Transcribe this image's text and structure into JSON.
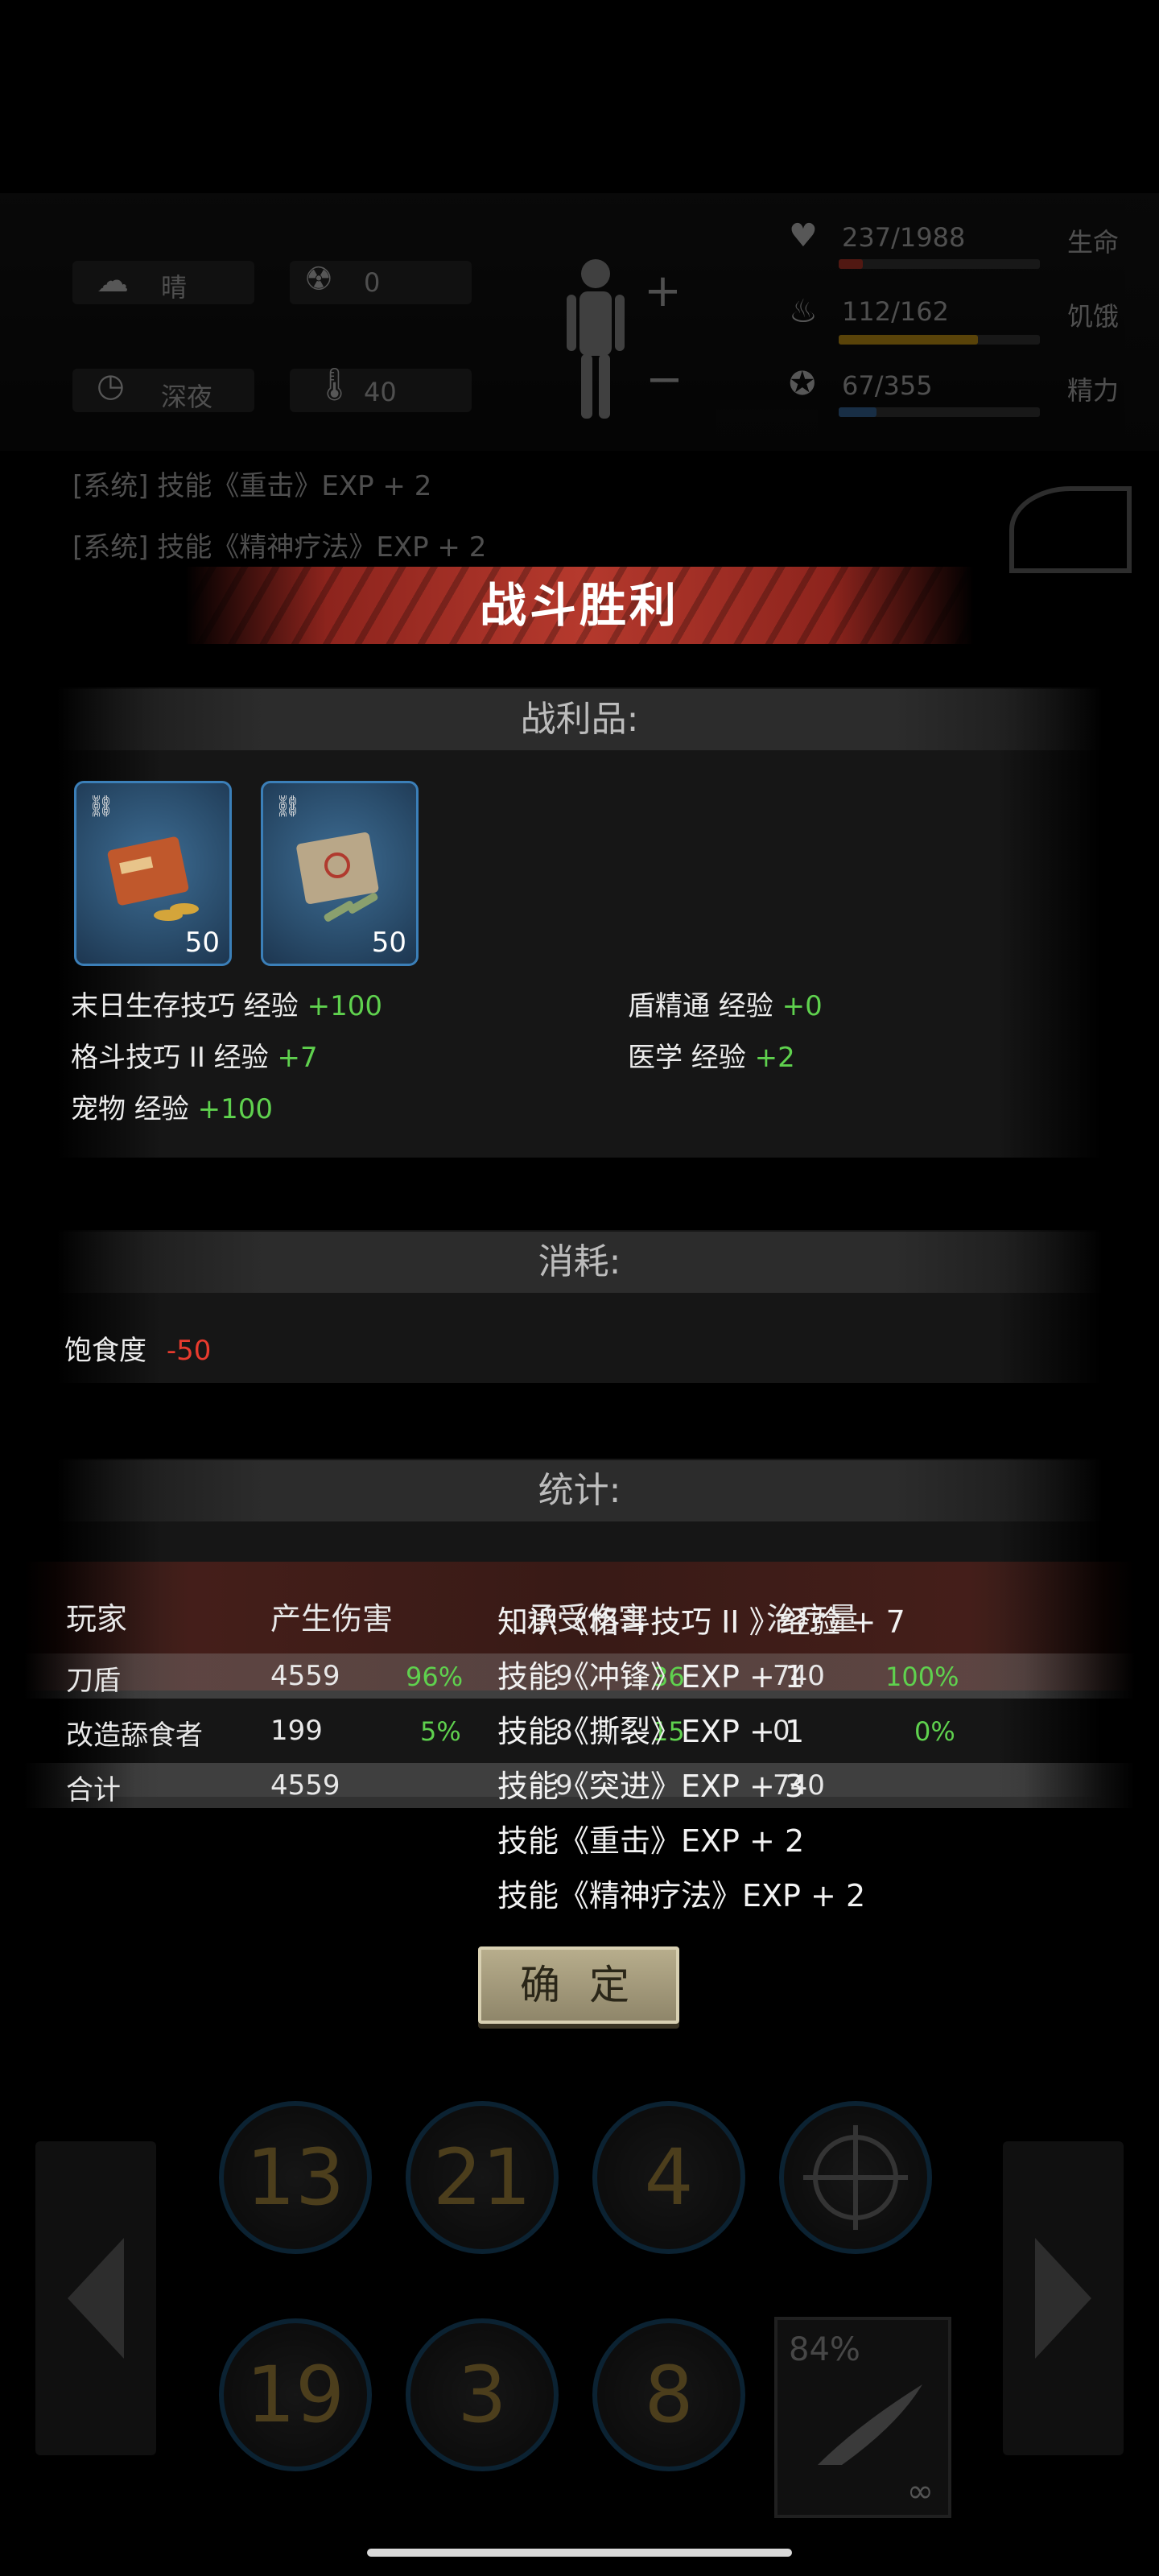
{
  "hud": {
    "weather": "晴",
    "radiation": "0",
    "time_of_day": "深夜",
    "temperature": "40",
    "hp": {
      "text": "237/1988",
      "label": "生命",
      "fraction": 0.119,
      "color": "#c0392b"
    },
    "hunger": {
      "text": "112/162",
      "label": "饥饿",
      "fraction": 0.691,
      "color": "#d4a017"
    },
    "energy": {
      "text": "67/355",
      "label": "精力",
      "fraction": 0.189,
      "color": "#3a6ea5"
    }
  },
  "system_log": [
    "[系统] 技能《重击》EXP + 2",
    "[系统] 技能《精神疗法》EXP + 2"
  ],
  "title": "战斗胜利",
  "loot": {
    "header": "战利品:",
    "items": [
      {
        "name": "ammo-box-1",
        "count": "50"
      },
      {
        "name": "ammo-box-2",
        "count": "50"
      }
    ],
    "exp_gains": [
      {
        "label": "末日生存技巧 经验",
        "value": "+100"
      },
      {
        "label": "盾精通 经验",
        "value": "+0"
      },
      {
        "label": "格斗技巧 II 经验",
        "value": "+7"
      },
      {
        "label": "医学 经验",
        "value": "+2"
      },
      {
        "label": "宠物 经验",
        "value": "+100"
      }
    ]
  },
  "consume": {
    "header": "消耗:",
    "label": "饱食度",
    "value": "-50"
  },
  "stats": {
    "header": "统计:",
    "columns": [
      "玩家",
      "产生伤害",
      "承受伤害",
      "治疗量"
    ],
    "rows": [
      {
        "player": "刀盾",
        "damage": "4559",
        "damage_pct": "96%",
        "taken": "9",
        "taken_pct": "36",
        "heal": "740",
        "heal_pct": "100%"
      },
      {
        "player": "改造舔食者",
        "damage": "199",
        "damage_pct": "5%",
        "taken": "8",
        "taken_pct": "15",
        "heal": "0",
        "heal_pct": "0%"
      },
      {
        "player": "合计",
        "damage": "4559",
        "damage_pct": "",
        "taken": "9",
        "taken_pct": "",
        "heal": "740",
        "heal_pct": ""
      }
    ]
  },
  "overlay_messages": [
    "知识《格斗技巧 II 》经验 + 7",
    "技能《冲锋》EXP + 1",
    "技能《撕裂》EXP + 1",
    "技能《突进》EXP + 3",
    "技能《重击》EXP + 2",
    "技能《精神疗法》EXP + 2"
  ],
  "confirm_label": "确 定",
  "skills": {
    "row1": [
      "13",
      "21",
      "4",
      ""
    ],
    "row2": [
      "19",
      "3",
      "8"
    ],
    "weapon": {
      "durability": "84%",
      "ammo": "∞"
    }
  }
}
